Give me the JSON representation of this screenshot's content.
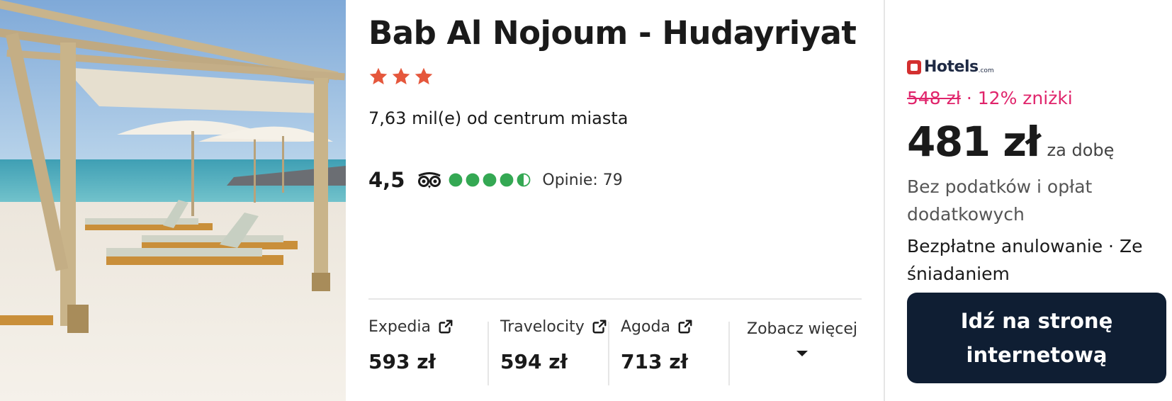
{
  "hotel": {
    "title": "Bab Al Nojoum - Hudayriyat",
    "star_count": 3,
    "distance": "7,63 mil(e) od centrum miasta",
    "rating": "4,5",
    "rating_bubbles": 4.5,
    "reviews": "Opinie: 79"
  },
  "partners": [
    {
      "name": "Expedia",
      "price": "593 zł"
    },
    {
      "name": "Travelocity",
      "price": "594 zł"
    },
    {
      "name": "Agoda",
      "price": "713 zł"
    }
  ],
  "see_more": {
    "label": "Zobacz więcej"
  },
  "offer": {
    "provider": "Hotels",
    "provider_suffix": ".com",
    "old_price": "548 zł",
    "discount": "12% zniżki",
    "separator": "·",
    "price": "481 zł",
    "per_night": "za dobę",
    "taxes_note": "Bez podatków i opłat dodatkowych",
    "amenities": "Bezpłatne anulowanie · Ze śniadaniem",
    "cta_label": "Idź na stronę internetową"
  },
  "colors": {
    "star": "#e5573c",
    "bubble": "#34a853",
    "discount": "#e0246b",
    "cta_bg": "#0f1e33"
  },
  "icons": {
    "photo": "beach-photo",
    "star": "star-icon",
    "tripadvisor": "tripadvisor-owl-icon",
    "external": "external-link-icon",
    "caret": "caret-down-icon"
  }
}
